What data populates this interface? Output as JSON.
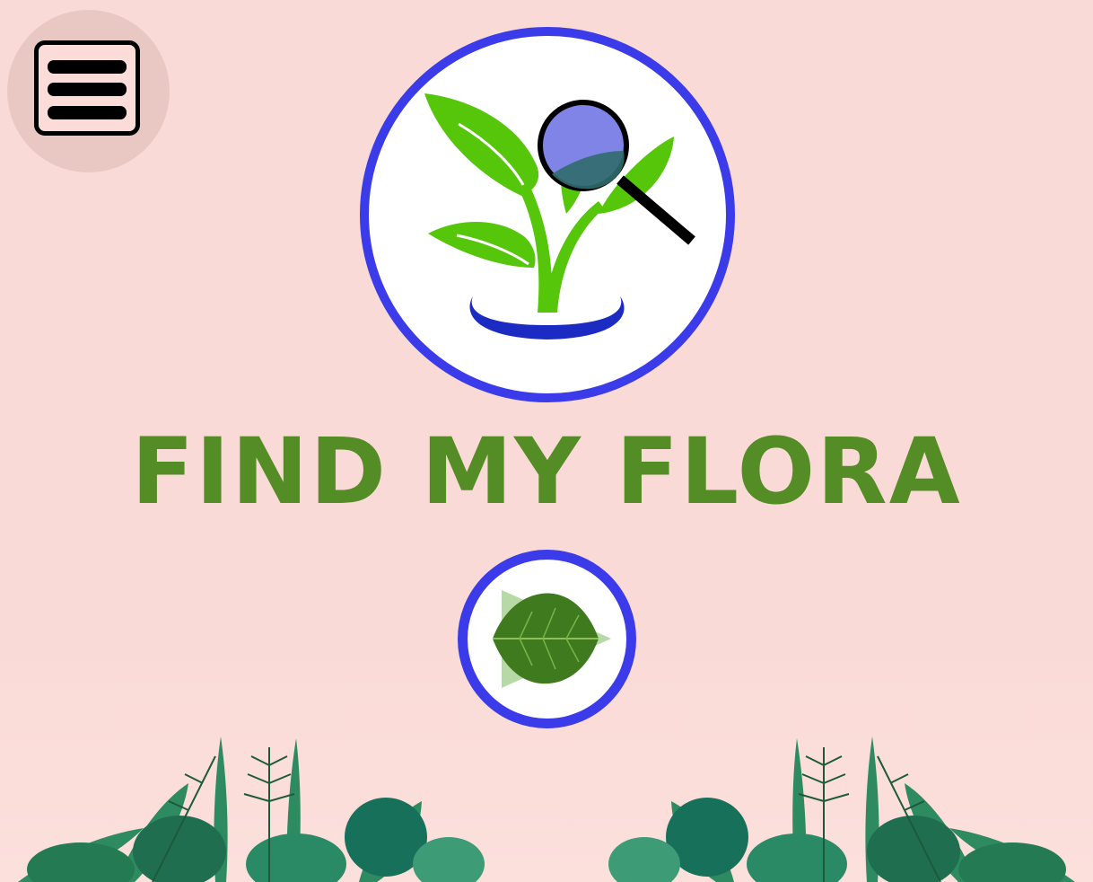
{
  "app": {
    "title": "FIND MY FLORA"
  },
  "menu": {
    "icon": "hamburger-menu-icon"
  },
  "logo": {
    "icon": "plant-magnifier-logo"
  },
  "start": {
    "icon": "leaf-play-icon"
  },
  "decor": {
    "icon": "tropical-foliage-illustration"
  },
  "colors": {
    "background": "#fadad6",
    "title": "#548c25",
    "ring": "#3d3de9",
    "leaf": "#56c60a"
  }
}
